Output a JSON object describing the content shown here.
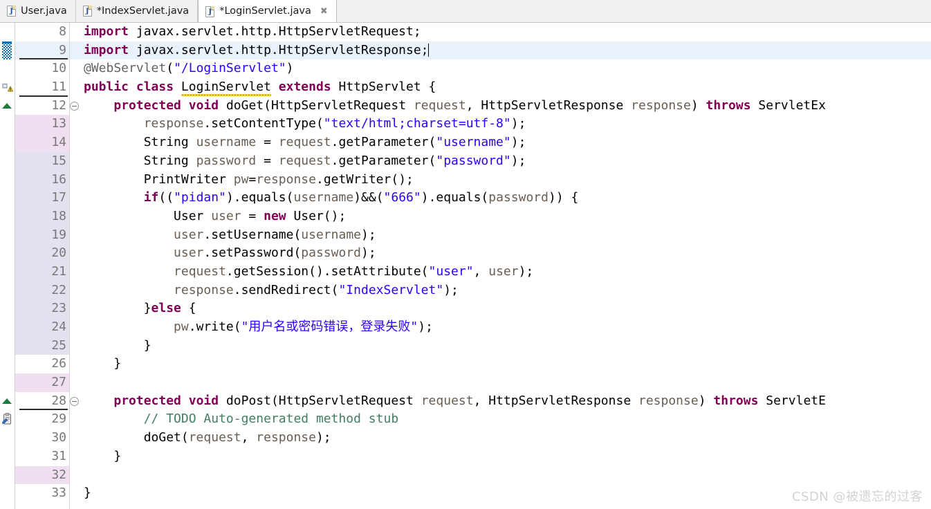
{
  "tabs": [
    {
      "label": "User.java",
      "icon": "java-file-icon",
      "active": false,
      "dirty": false
    },
    {
      "label": "*IndexServlet.java",
      "icon": "java-file-icon",
      "active": false,
      "dirty": true
    },
    {
      "label": "*LoginServlet.java",
      "icon": "java-file-icon",
      "active": true,
      "dirty": true,
      "close_glyph": "✖"
    }
  ],
  "editor": {
    "first_visible_line": 8,
    "caret_line": 9,
    "language": "java",
    "lines": [
      {
        "number": "8",
        "marker": "none",
        "fold": "none",
        "gutter_tint": "none",
        "current": false,
        "tokens": [
          {
            "t": "import",
            "c": "kw"
          },
          {
            "t": " javax.servlet.http.HttpServletRequest;",
            "c": "plain"
          }
        ]
      },
      {
        "number": "9",
        "marker": "quick-diff-added",
        "fold": "none",
        "gutter_tint": "none",
        "current": true,
        "underline": true,
        "tokens": [
          {
            "t": "import",
            "c": "kw"
          },
          {
            "t": " javax.servlet.http.HttpServletResponse;",
            "c": "plain"
          }
        ],
        "caret_after": true
      },
      {
        "number": "10",
        "marker": "none",
        "fold": "none",
        "gutter_tint": "none",
        "current": false,
        "tokens": [
          {
            "t": "@WebServlet",
            "c": "ann2"
          },
          {
            "t": "(",
            "c": "plain"
          },
          {
            "t": "\"/LoginServlet\"",
            "c": "str"
          },
          {
            "t": ")",
            "c": "plain"
          }
        ]
      },
      {
        "number": "11",
        "marker": "warning",
        "fold": "none",
        "gutter_tint": "none",
        "current": false,
        "underline": true,
        "tokens": [
          {
            "t": "public",
            "c": "kw"
          },
          {
            "t": " ",
            "c": "plain"
          },
          {
            "t": "class",
            "c": "kw"
          },
          {
            "t": " ",
            "c": "plain"
          },
          {
            "t": "LoginServlet",
            "c": "plain",
            "squiggle": true
          },
          {
            "t": " ",
            "c": "plain"
          },
          {
            "t": "extends",
            "c": "kw"
          },
          {
            "t": " HttpServlet {",
            "c": "plain"
          }
        ]
      },
      {
        "number": "12",
        "marker": "override",
        "fold": "collapse",
        "gutter_tint": "none",
        "current": false,
        "tokens": [
          {
            "t": "    ",
            "c": "plain"
          },
          {
            "t": "protected",
            "c": "kw"
          },
          {
            "t": " ",
            "c": "plain"
          },
          {
            "t": "void",
            "c": "kw"
          },
          {
            "t": " doGet(HttpServletRequest ",
            "c": "plain"
          },
          {
            "t": "request",
            "c": "loc"
          },
          {
            "t": ", HttpServletResponse ",
            "c": "plain"
          },
          {
            "t": "response",
            "c": "loc"
          },
          {
            "t": ") ",
            "c": "plain"
          },
          {
            "t": "throws",
            "c": "kw"
          },
          {
            "t": " ServletEx",
            "c": "plain"
          }
        ]
      },
      {
        "number": "13",
        "marker": "none",
        "fold": "none",
        "gutter_tint": "pink",
        "current": false,
        "tokens": [
          {
            "t": "        ",
            "c": "plain"
          },
          {
            "t": "response",
            "c": "loc"
          },
          {
            "t": ".setContentType(",
            "c": "plain"
          },
          {
            "t": "\"text/html;charset=utf-8\"",
            "c": "str"
          },
          {
            "t": ");",
            "c": "plain"
          }
        ]
      },
      {
        "number": "14",
        "marker": "none",
        "fold": "none",
        "gutter_tint": "pink",
        "current": false,
        "tokens": [
          {
            "t": "        String ",
            "c": "plain"
          },
          {
            "t": "username",
            "c": "loc"
          },
          {
            "t": " = ",
            "c": "plain"
          },
          {
            "t": "request",
            "c": "loc"
          },
          {
            "t": ".getParameter(",
            "c": "plain"
          },
          {
            "t": "\"username\"",
            "c": "str"
          },
          {
            "t": ");",
            "c": "plain"
          }
        ]
      },
      {
        "number": "15",
        "marker": "none",
        "fold": "none",
        "gutter_tint": "lav",
        "current": false,
        "tokens": [
          {
            "t": "        String ",
            "c": "plain"
          },
          {
            "t": "password",
            "c": "loc"
          },
          {
            "t": " = ",
            "c": "plain"
          },
          {
            "t": "request",
            "c": "loc"
          },
          {
            "t": ".getParameter(",
            "c": "plain"
          },
          {
            "t": "\"password\"",
            "c": "str"
          },
          {
            "t": ");",
            "c": "plain"
          }
        ]
      },
      {
        "number": "16",
        "marker": "none",
        "fold": "none",
        "gutter_tint": "lav",
        "current": false,
        "tokens": [
          {
            "t": "        PrintWriter ",
            "c": "plain"
          },
          {
            "t": "pw",
            "c": "loc"
          },
          {
            "t": "=",
            "c": "plain"
          },
          {
            "t": "response",
            "c": "loc"
          },
          {
            "t": ".getWriter();",
            "c": "plain"
          }
        ]
      },
      {
        "number": "17",
        "marker": "none",
        "fold": "none",
        "gutter_tint": "lav",
        "current": false,
        "tokens": [
          {
            "t": "        ",
            "c": "plain"
          },
          {
            "t": "if",
            "c": "kw"
          },
          {
            "t": "((",
            "c": "plain"
          },
          {
            "t": "\"pidan\"",
            "c": "str"
          },
          {
            "t": ").equals(",
            "c": "plain"
          },
          {
            "t": "username",
            "c": "loc"
          },
          {
            "t": ")&&(",
            "c": "plain"
          },
          {
            "t": "\"666\"",
            "c": "str"
          },
          {
            "t": ").equals(",
            "c": "plain"
          },
          {
            "t": "password",
            "c": "loc"
          },
          {
            "t": ")) {",
            "c": "plain"
          }
        ]
      },
      {
        "number": "18",
        "marker": "none",
        "fold": "none",
        "gutter_tint": "lav",
        "current": false,
        "tokens": [
          {
            "t": "            User ",
            "c": "plain"
          },
          {
            "t": "user",
            "c": "loc"
          },
          {
            "t": " = ",
            "c": "plain"
          },
          {
            "t": "new",
            "c": "kw"
          },
          {
            "t": " User();",
            "c": "plain"
          }
        ]
      },
      {
        "number": "19",
        "marker": "none",
        "fold": "none",
        "gutter_tint": "lav",
        "current": false,
        "tokens": [
          {
            "t": "            ",
            "c": "plain"
          },
          {
            "t": "user",
            "c": "loc"
          },
          {
            "t": ".setUsername(",
            "c": "plain"
          },
          {
            "t": "username",
            "c": "loc"
          },
          {
            "t": ");",
            "c": "plain"
          }
        ]
      },
      {
        "number": "20",
        "marker": "none",
        "fold": "none",
        "gutter_tint": "lav",
        "current": false,
        "tokens": [
          {
            "t": "            ",
            "c": "plain"
          },
          {
            "t": "user",
            "c": "loc"
          },
          {
            "t": ".setPassword(",
            "c": "plain"
          },
          {
            "t": "password",
            "c": "loc"
          },
          {
            "t": ");",
            "c": "plain"
          }
        ]
      },
      {
        "number": "21",
        "marker": "none",
        "fold": "none",
        "gutter_tint": "lav",
        "current": false,
        "tokens": [
          {
            "t": "            ",
            "c": "plain"
          },
          {
            "t": "request",
            "c": "loc"
          },
          {
            "t": ".getSession().setAttribute(",
            "c": "plain"
          },
          {
            "t": "\"user\"",
            "c": "str"
          },
          {
            "t": ", ",
            "c": "plain"
          },
          {
            "t": "user",
            "c": "loc"
          },
          {
            "t": ");",
            "c": "plain"
          }
        ]
      },
      {
        "number": "22",
        "marker": "none",
        "fold": "none",
        "gutter_tint": "lav",
        "current": false,
        "tokens": [
          {
            "t": "            ",
            "c": "plain"
          },
          {
            "t": "response",
            "c": "loc"
          },
          {
            "t": ".sendRedirect(",
            "c": "plain"
          },
          {
            "t": "\"IndexServlet\"",
            "c": "str"
          },
          {
            "t": ");",
            "c": "plain"
          }
        ]
      },
      {
        "number": "23",
        "marker": "none",
        "fold": "none",
        "gutter_tint": "lav",
        "current": false,
        "tokens": [
          {
            "t": "        }",
            "c": "plain"
          },
          {
            "t": "else",
            "c": "kw"
          },
          {
            "t": " {",
            "c": "plain"
          }
        ]
      },
      {
        "number": "24",
        "marker": "none",
        "fold": "none",
        "gutter_tint": "lav",
        "current": false,
        "tokens": [
          {
            "t": "            ",
            "c": "plain"
          },
          {
            "t": "pw",
            "c": "loc"
          },
          {
            "t": ".write(",
            "c": "plain"
          },
          {
            "t": "\"用户名或密码错误，登录失败\"",
            "c": "str"
          },
          {
            "t": ");",
            "c": "plain"
          }
        ]
      },
      {
        "number": "25",
        "marker": "none",
        "fold": "none",
        "gutter_tint": "lav",
        "current": false,
        "tokens": [
          {
            "t": "        }",
            "c": "plain"
          }
        ]
      },
      {
        "number": "26",
        "marker": "none",
        "fold": "none",
        "gutter_tint": "none",
        "current": false,
        "tokens": [
          {
            "t": "    }",
            "c": "plain"
          }
        ]
      },
      {
        "number": "27",
        "marker": "none",
        "fold": "none",
        "gutter_tint": "pink",
        "current": false,
        "tokens": [
          {
            "t": "",
            "c": "plain"
          }
        ]
      },
      {
        "number": "28",
        "marker": "override",
        "fold": "collapse",
        "gutter_tint": "none",
        "current": false,
        "underline": true,
        "tokens": [
          {
            "t": "    ",
            "c": "plain"
          },
          {
            "t": "protected",
            "c": "kw"
          },
          {
            "t": " ",
            "c": "plain"
          },
          {
            "t": "void",
            "c": "kw"
          },
          {
            "t": " doPost(HttpServletRequest ",
            "c": "plain"
          },
          {
            "t": "request",
            "c": "loc"
          },
          {
            "t": ", HttpServletResponse ",
            "c": "plain"
          },
          {
            "t": "response",
            "c": "loc"
          },
          {
            "t": ") ",
            "c": "plain"
          },
          {
            "t": "throws",
            "c": "kw"
          },
          {
            "t": " ServletE",
            "c": "plain"
          }
        ]
      },
      {
        "number": "29",
        "marker": "todo",
        "fold": "none",
        "gutter_tint": "none",
        "current": false,
        "tokens": [
          {
            "t": "        ",
            "c": "plain"
          },
          {
            "t": "// TODO Auto-generated method stub",
            "c": "cmt"
          }
        ]
      },
      {
        "number": "30",
        "marker": "none",
        "fold": "none",
        "gutter_tint": "none",
        "current": false,
        "tokens": [
          {
            "t": "        doGet(",
            "c": "plain"
          },
          {
            "t": "request",
            "c": "loc"
          },
          {
            "t": ", ",
            "c": "plain"
          },
          {
            "t": "response",
            "c": "loc"
          },
          {
            "t": ");",
            "c": "plain"
          }
        ]
      },
      {
        "number": "31",
        "marker": "none",
        "fold": "none",
        "gutter_tint": "none",
        "current": false,
        "tokens": [
          {
            "t": "    }",
            "c": "plain"
          }
        ]
      },
      {
        "number": "32",
        "marker": "none",
        "fold": "none",
        "gutter_tint": "pink",
        "current": false,
        "tokens": [
          {
            "t": "",
            "c": "plain"
          }
        ]
      },
      {
        "number": "33",
        "marker": "none",
        "fold": "none",
        "gutter_tint": "none",
        "current": false,
        "tokens": [
          {
            "t": "}",
            "c": "plain"
          }
        ]
      }
    ]
  },
  "watermark": {
    "text": "CSDN @被遗忘的过客"
  },
  "colors": {
    "keyword": "#7f0055",
    "string": "#2a00ff",
    "comment": "#3f7f5f",
    "annotation": "#646464",
    "local_var": "#6a5d52",
    "current_line_bg": "#e9f2fb",
    "gutter_pink": "#f0dff0",
    "gutter_lavender": "#e3e1ef",
    "tab_active_bg": "#ffffff",
    "tab_inactive_bg": "#f2f1f0"
  }
}
